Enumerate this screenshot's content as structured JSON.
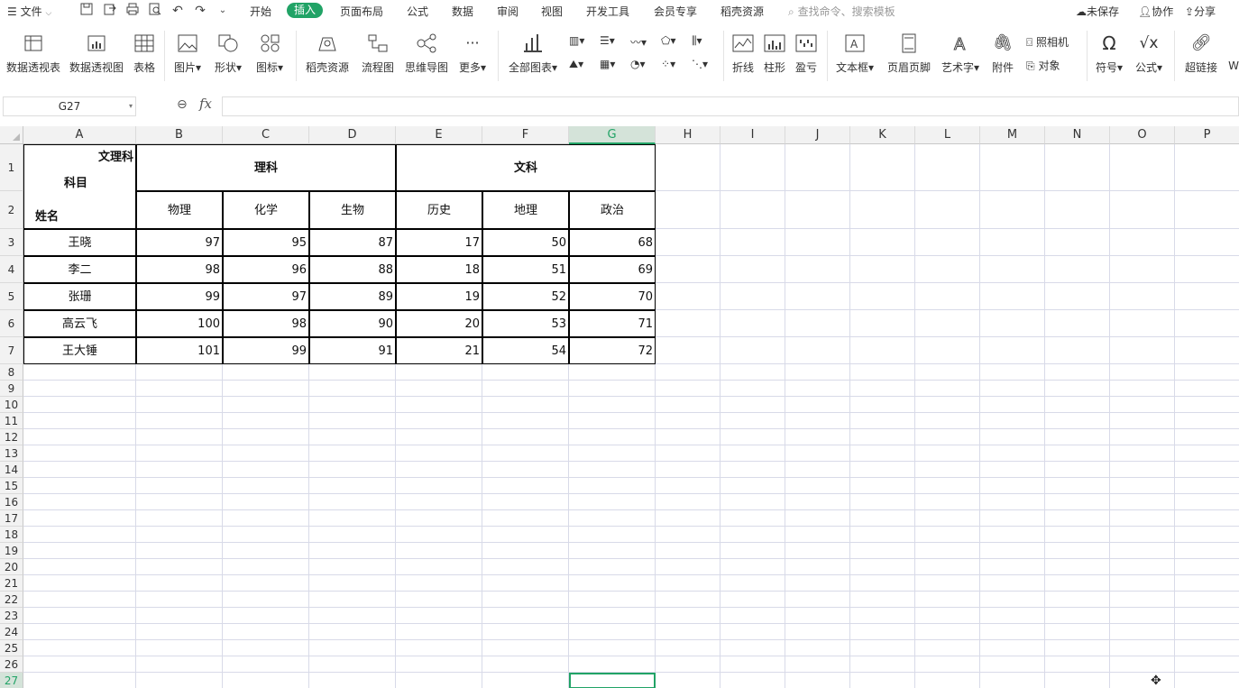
{
  "menubar": {
    "file_label": "文件",
    "tabs": [
      "开始",
      "插入",
      "页面布局",
      "公式",
      "数据",
      "审阅",
      "视图",
      "开发工具",
      "会员专享",
      "稻壳资源"
    ],
    "active_tab": "插入",
    "search_placeholder": "查找命令、搜索模板",
    "unsaved": "未保存",
    "collab": "协作",
    "share": "分享"
  },
  "ribbon": {
    "pivot_table": "数据透视表",
    "pivot_chart": "数据透视图",
    "table": "表格",
    "picture": "图片",
    "shape": "形状",
    "icon": "图标",
    "docer": "稻壳资源",
    "flowchart": "流程图",
    "mindmap": "思维导图",
    "more": "更多",
    "all_charts": "全部图表",
    "line": "折线",
    "column": "柱形",
    "winloss": "盈亏",
    "textbox": "文本框",
    "header_footer": "页眉页脚",
    "wordart": "艺术字",
    "attachment": "附件",
    "camera": "照相机",
    "object": "对象",
    "symbol": "符号",
    "formula": "公式",
    "hyperlink": "超链接",
    "cut_off": "W"
  },
  "formula_bar": {
    "name_box": "G27",
    "fx": "fx",
    "content": ""
  },
  "grid": {
    "columns": [
      "A",
      "B",
      "C",
      "D",
      "E",
      "F",
      "G",
      "H",
      "I",
      "J",
      "K",
      "L",
      "M",
      "N",
      "O",
      "P"
    ],
    "selected_column": "G",
    "selected_row": "27",
    "rows": [
      "1",
      "2",
      "3",
      "4",
      "5",
      "6",
      "7",
      "8",
      "9",
      "10",
      "11",
      "12",
      "13",
      "14",
      "15",
      "16",
      "17",
      "18",
      "19",
      "20",
      "21",
      "22",
      "23",
      "24",
      "25",
      "26",
      "27"
    ]
  },
  "table": {
    "header_corner": {
      "top": "文理科",
      "mid": "科目",
      "bottom": "姓名"
    },
    "group_science": "理科",
    "group_arts": "文科",
    "subjects": [
      "物理",
      "化学",
      "生物",
      "历史",
      "地理",
      "政治"
    ],
    "students": [
      {
        "name": "王晓",
        "scores": [
          "97",
          "95",
          "87",
          "17",
          "50",
          "68"
        ]
      },
      {
        "name": "李二",
        "scores": [
          "98",
          "96",
          "88",
          "18",
          "51",
          "69"
        ]
      },
      {
        "name": "张珊",
        "scores": [
          "99",
          "97",
          "89",
          "19",
          "52",
          "70"
        ]
      },
      {
        "name": "高云飞",
        "scores": [
          "100",
          "98",
          "90",
          "20",
          "53",
          "71"
        ]
      },
      {
        "name": "王大锤",
        "scores": [
          "101",
          "99",
          "91",
          "21",
          "54",
          "72"
        ]
      }
    ]
  },
  "colors": {
    "accent": "#21a366",
    "grid_line": "#d8dae8"
  }
}
